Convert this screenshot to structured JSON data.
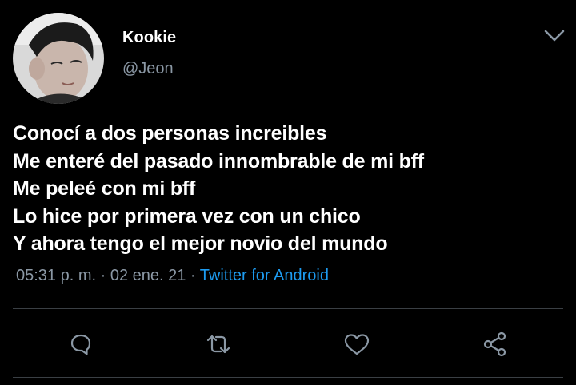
{
  "tweet": {
    "author_name": "Kookie",
    "author_handle": "@Jeon",
    "lines": [
      "Conocí a dos personas increibles",
      "Me enteré del pasado innombrable de mi bff",
      "Me peleé con mi bff",
      "Lo hice por primera vez con un chico",
      "Y ahora tengo el mejor novio del mundo"
    ],
    "time": "05:31 p. m.",
    "separator": " · ",
    "date": "02 ene. 21",
    "source": "Twitter for Android"
  },
  "icons": {
    "menu": "chevron-down-icon",
    "reply": "reply-icon",
    "retweet": "retweet-icon",
    "like": "heart-icon",
    "share": "share-icon"
  },
  "colors": {
    "background": "#000000",
    "text": "#ffffff",
    "muted": "#8b98a5",
    "accent": "#1d9bf0",
    "divider": "#3a3f44"
  }
}
